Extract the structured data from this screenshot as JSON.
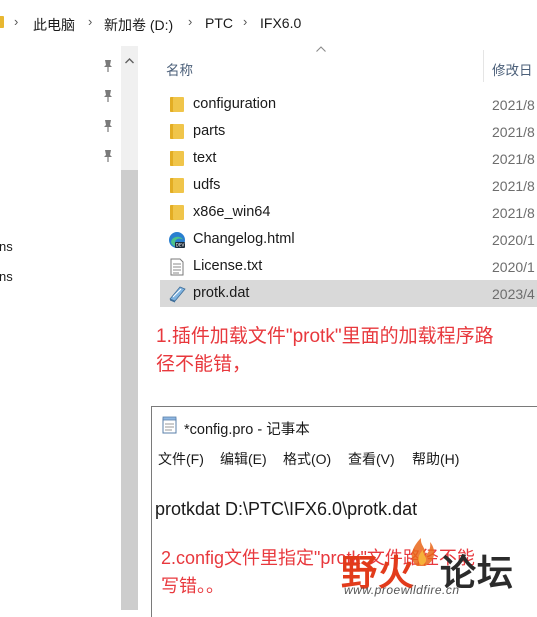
{
  "address_bar": {
    "crumbs": [
      "此电脑",
      "新加卷 (D:)",
      "PTC",
      "IFX6.0"
    ]
  },
  "nav": {
    "partial_items": [
      "ns",
      "ns"
    ]
  },
  "file_list": {
    "col_name": "名称",
    "col_date": "修改日",
    "rows": [
      {
        "name": "configuration",
        "date": "2021/8",
        "icon": "folder-icon"
      },
      {
        "name": "parts",
        "date": "2021/8",
        "icon": "folder-icon"
      },
      {
        "name": "text",
        "date": "2021/8",
        "icon": "folder-icon"
      },
      {
        "name": "udfs",
        "date": "2021/8",
        "icon": "folder-icon"
      },
      {
        "name": "x86e_win64",
        "date": "2021/8",
        "icon": "folder-icon"
      },
      {
        "name": "Changelog.html",
        "date": "2020/1",
        "icon": "edge-dev-icon"
      },
      {
        "name": "License.txt",
        "date": "2020/1",
        "icon": "text-file-icon"
      },
      {
        "name": "protk.dat",
        "date": "2023/4",
        "icon": "dat-file-icon",
        "selected": true
      }
    ]
  },
  "annotation1": {
    "line1": "1.插件加载文件\"protk\"里面的加载程序路",
    "line2": "径不能错，"
  },
  "notepad": {
    "title": "*config.pro - 记事本",
    "menu": [
      "文件(F)",
      "编辑(E)",
      "格式(O)",
      "查看(V)",
      "帮助(H)"
    ],
    "content": "protkdat D:\\PTC\\IFX6.0\\protk.dat"
  },
  "annotation2": {
    "line1": "2.config文件里指定\"protk\"文件路径不能",
    "line2": "写错。。"
  },
  "watermark": {
    "text_red": "野火",
    "text_dark": "论坛",
    "url": "www.proewildfire.cn"
  },
  "colors": {
    "annotation": "#e8383d",
    "selection": "#d9d9d9",
    "folder": "#f0c54a"
  }
}
